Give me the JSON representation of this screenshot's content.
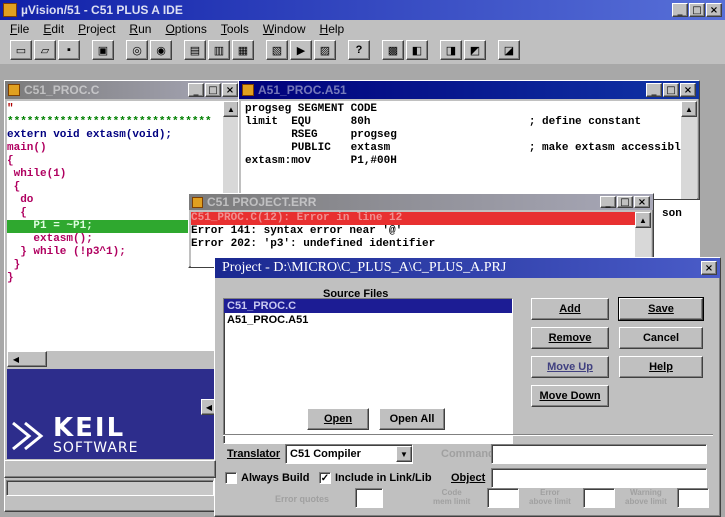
{
  "app": {
    "title": "µVision/51 - C51 PLUS A IDE",
    "menu": [
      "File",
      "Edit",
      "Project",
      "Run",
      "Options",
      "Tools",
      "Window",
      "Help"
    ],
    "toolbar_icons": [
      "new-file-icon",
      "open-file-icon",
      "save-file-icon",
      "print-icon",
      "find-icon",
      "find-next-icon",
      "compile-icon",
      "build-icon",
      "make-icon",
      "debug-icon",
      "run-icon",
      "help-icon",
      "project-icon",
      "options-icon",
      "window-icon",
      "tile-icon"
    ]
  },
  "window_buttons": {
    "min": "_",
    "max": "□",
    "close": "×"
  },
  "c_editor": {
    "title": "C51_PROC.C",
    "lines": [
      "\"",
      "*******************************",
      "",
      "extern void extasm(void);",
      "",
      "main()",
      "",
      "{",
      " while(1)",
      " {",
      "  do",
      "  {",
      "    P1 = ~P1;",
      "    extasm();",
      "  } while (!p3^1);",
      " }",
      "}"
    ],
    "highlight_line": 12
  },
  "asm_editor": {
    "title": "A51_PROC.A51",
    "lines": [
      "progseg SEGMENT CODE",
      "",
      "limit  EQU      80h                        ; define constant",
      "",
      "       RSEG     progseg",
      "       PUBLIC   extasm                     ; make extasm accessible",
      "extasm:mov      P1,#00H"
    ],
    "clipped_right": "son"
  },
  "error_window": {
    "title": "C51 PROJECT.ERR",
    "highlight": "C51_PROC.C(12): Error in line 12",
    "errors": [
      "Error 141: syntax error near '@'",
      "Error 202: 'p3': undefined identifier"
    ]
  },
  "project_dialog": {
    "title": "Project - D:\\MICRO\\C_PLUS_A\\C_PLUS_A.PRJ",
    "source_files_label": "Source Files",
    "files": [
      "C51_PROC.C",
      "A51_PROC.A51"
    ],
    "selected_file": 0,
    "buttons": {
      "add": "Add",
      "remove": "Remove",
      "move_up": "Move Up",
      "move_down": "Move Down",
      "save": "Save",
      "cancel": "Cancel",
      "help": "Help",
      "open": "Open",
      "open_all": "Open All"
    },
    "translator_label": "Translator",
    "translator_value": "C51 Compiler",
    "always_build_label": "Always Build",
    "always_build_checked": false,
    "include_label": "Include in Link/Lib",
    "include_checked": true,
    "command_label": "Command",
    "object_label": "Object",
    "bottom_labels": [
      "Error quotes",
      "Code\nmem limit",
      "Error\nabove limit",
      "Warning\nabove limit"
    ]
  },
  "logo": {
    "name": "KEIL",
    "sub": "SOFTWARE"
  }
}
